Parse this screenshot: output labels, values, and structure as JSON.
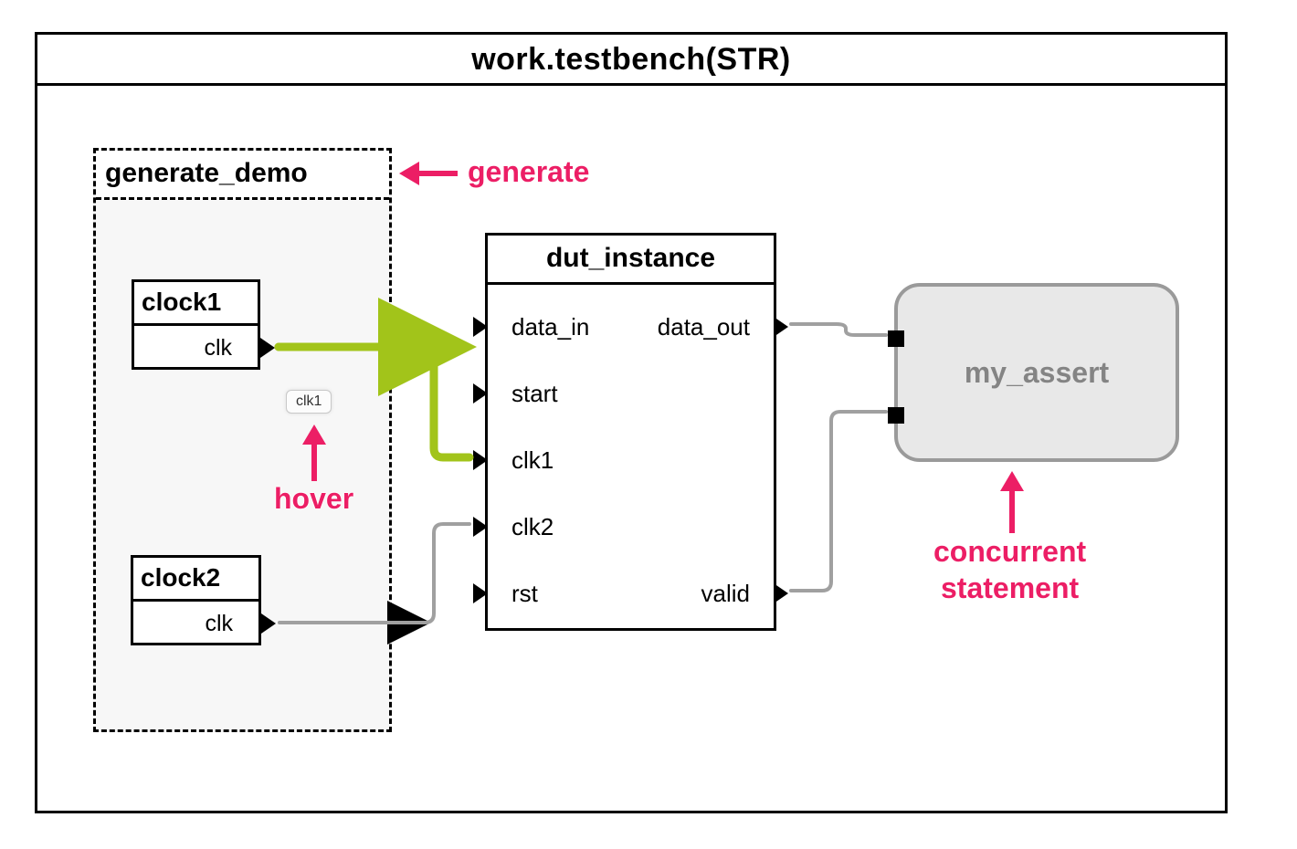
{
  "title": "work.testbench(STR)",
  "generate_block": {
    "label": "generate_demo"
  },
  "clock1": {
    "title": "clock1",
    "port": "clk"
  },
  "clock2": {
    "title": "clock2",
    "port": "clk"
  },
  "dut": {
    "title": "dut_instance",
    "inputs": [
      "data_in",
      "start",
      "clk1",
      "clk2",
      "rst"
    ],
    "outputs": [
      "data_out",
      "valid"
    ]
  },
  "assert_block": {
    "label": "my_assert"
  },
  "tooltip": "clk1",
  "annotations": {
    "generate": "generate",
    "hover": "hover",
    "concurrent1": "concurrent",
    "concurrent2": "statement"
  },
  "colors": {
    "annotation": "#ec1e65",
    "highlight_wire": "#a2c41a",
    "normal_wire": "#a0a0a0"
  }
}
